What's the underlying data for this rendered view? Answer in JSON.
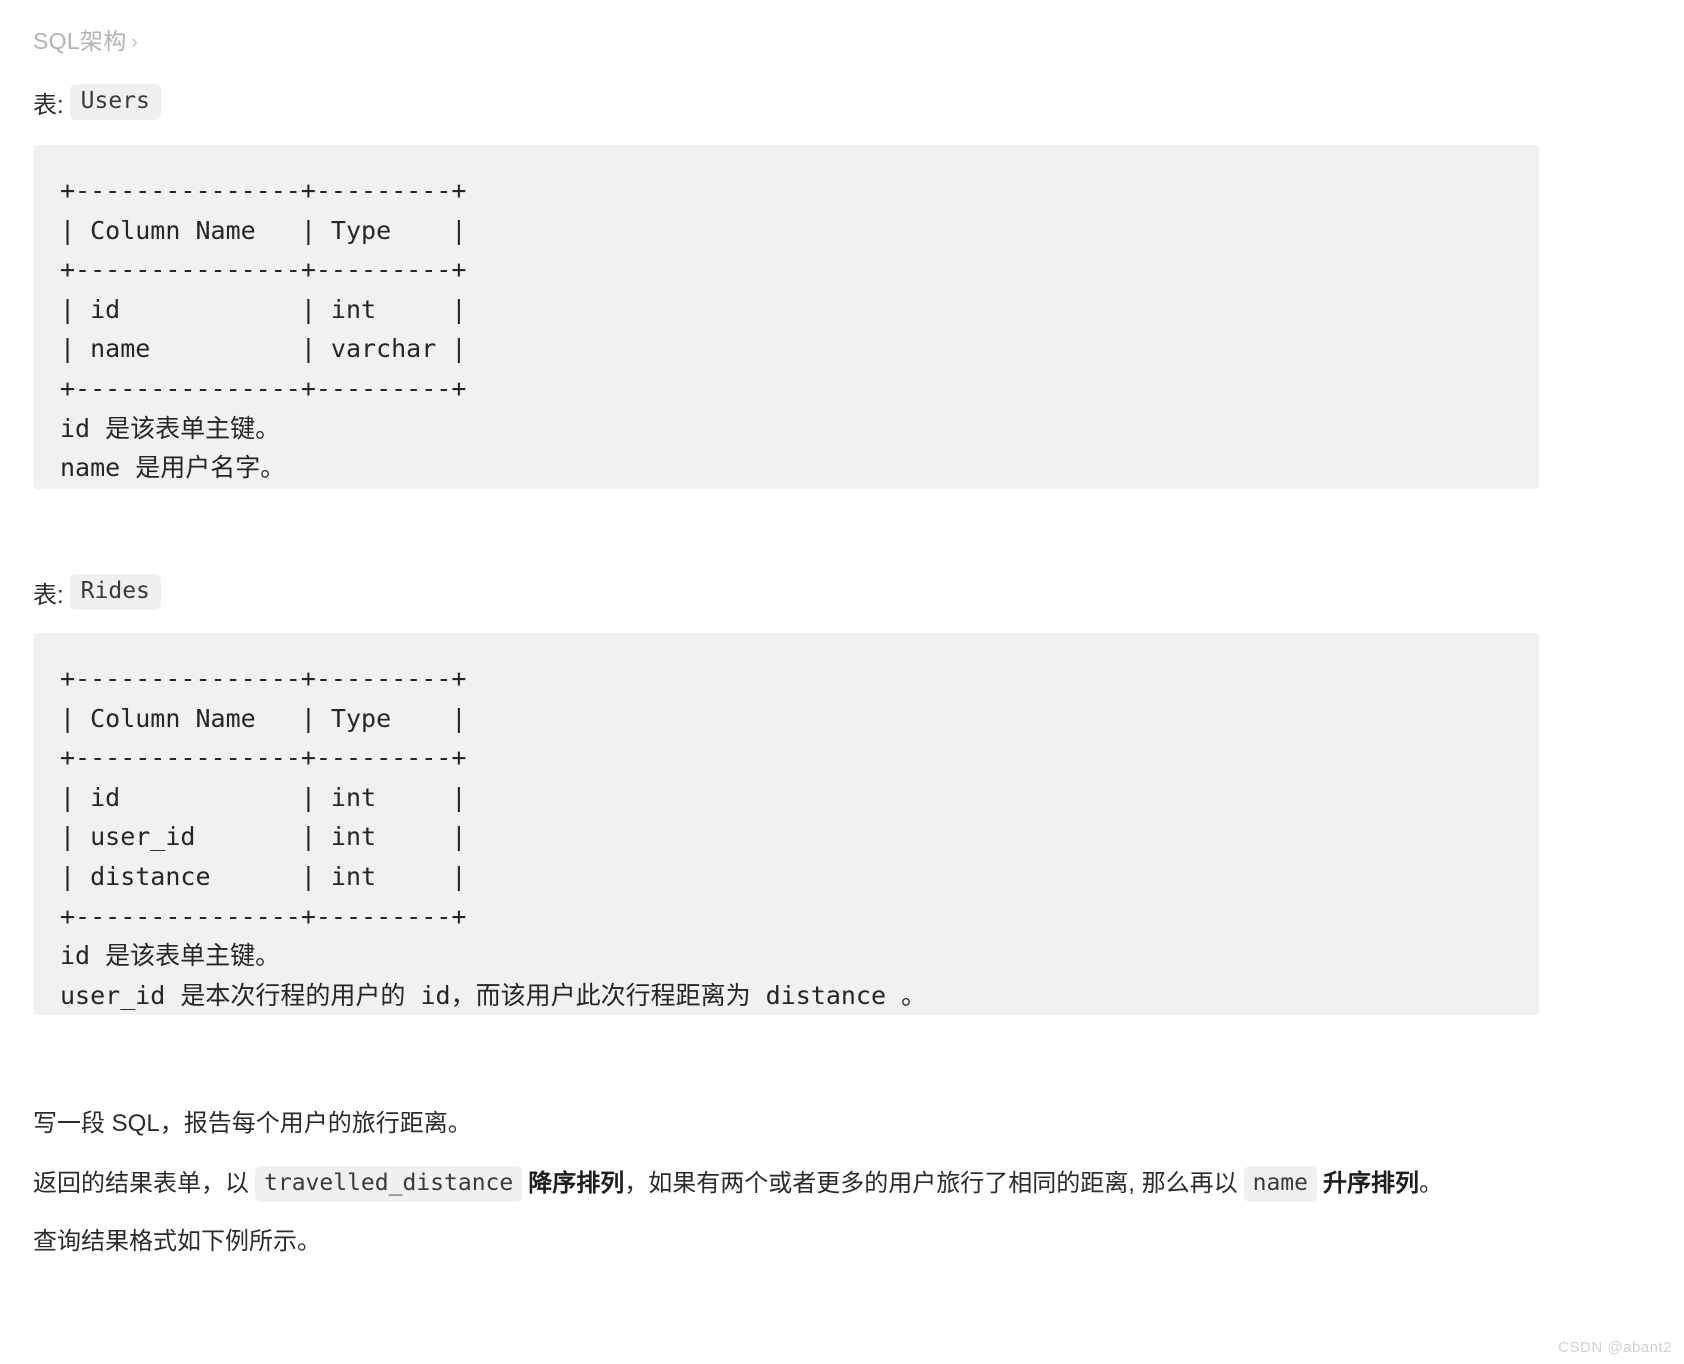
{
  "breadcrumb": {
    "label": "SQL架构",
    "separator": "›"
  },
  "tables": [
    {
      "label_prefix": "表:",
      "name": "Users",
      "ascii": "+---------------+---------+\n| Column Name   | Type    |\n+---------------+---------+\n| id            | int     |\n| name          | varchar |\n+---------------+---------+",
      "notes": "id 是该表单主键。\nname 是用户名字。"
    },
    {
      "label_prefix": "表:",
      "name": "Rides",
      "ascii": "+---------------+---------+\n| Column Name   | Type    |\n+---------------+---------+\n| id            | int     |\n| user_id       | int     |\n| distance      | int     |\n+---------------+---------+",
      "notes": "id 是该表单主键。\nuser_id 是本次行程的用户的 id，而该用户此次行程距离为 distance 。"
    }
  ],
  "prose": {
    "line1": "写一段 SQL，报告每个用户的旅行距离。",
    "line2": {
      "part1": "返回的结果表单，以",
      "code1": "travelled_distance",
      "bold1": "降序排列",
      "part2": "，如果有两个或者更多的用户旅行了相同的距离, 那么再以",
      "code2": "name",
      "bold2": "升序排列",
      "part3": "。"
    },
    "line3": "查询结果格式如下例所示。"
  },
  "watermark": "CSDN @abant2",
  "colors": {
    "panel_bg": "#f0f1f2",
    "chip_bg": "#f0f0f2",
    "text": "#2b2b2b",
    "breadcrumb": "#b3b3b3",
    "watermark": "#d2d2d2"
  }
}
